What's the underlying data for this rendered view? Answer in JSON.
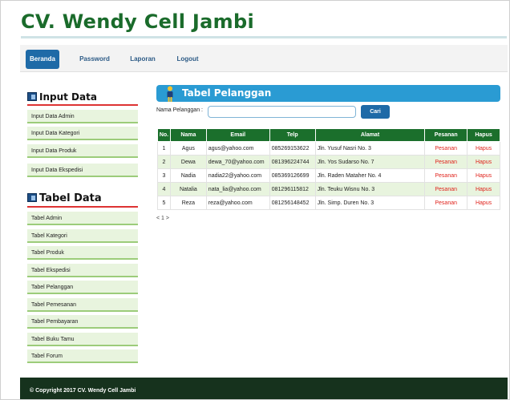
{
  "site": {
    "title": "CV. Wendy Cell Jambi"
  },
  "nav": [
    {
      "label": "Beranda",
      "active": true
    },
    {
      "label": "Password",
      "active": false
    },
    {
      "label": "Laporan",
      "active": false
    },
    {
      "label": "Logout",
      "active": false
    }
  ],
  "sidebar": {
    "input_heading": "Input Data",
    "input_items": [
      "Input Data Admin",
      "Input Data Kategori",
      "Input Data Produk",
      "Input Data Ekspedisi"
    ],
    "table_heading": "Tabel Data",
    "table_items": [
      "Tabel Admin",
      "Tabel Kategori",
      "Tabel Produk",
      "Tabel Ekspedisi",
      "Tabel Pelanggan",
      "Tabel Pemesanan",
      "Tabel Pembayaran",
      "Tabel Buku Tamu",
      "Tabel Forum"
    ]
  },
  "main": {
    "title": "Tabel Pelanggan",
    "search": {
      "label": "Nama Pelanggan :",
      "value": "",
      "placeholder": "",
      "button": "Cari"
    },
    "table": {
      "headers": [
        "No.",
        "Nama",
        "Email",
        "Telp",
        "Alamat",
        "Pesanan",
        "Hapus"
      ],
      "rows": [
        [
          "1",
          "Agus",
          "agus@yahoo.com",
          "085269153622",
          "Jln. Yusuf Nasri No. 3",
          "Pesanan",
          "Hapus"
        ],
        [
          "2",
          "Dewa",
          "dewa_70@yahoo.com",
          "081396224744",
          "Jln. Yos Sudarso No. 7",
          "Pesanan",
          "Hapus"
        ],
        [
          "3",
          "Nadia",
          "nadia22@yahoo.com",
          "085369126699",
          "Jln. Raden Mataher No. 4",
          "Pesanan",
          "Hapus"
        ],
        [
          "4",
          "Natalia",
          "nata_lia@yahoo.com",
          "081296115812",
          "Jln. Teuku Wisnu No. 3",
          "Pesanan",
          "Hapus"
        ],
        [
          "5",
          "Reza",
          "reza@yahoo.com",
          "081256148452",
          "Jln. Simp. Duren No. 3",
          "Pesanan",
          "Hapus"
        ]
      ]
    },
    "pager": "< 1 >"
  },
  "footer": {
    "text": "© Copyright 2017 CV. Wendy Cell Jambi"
  },
  "colors": {
    "brand_green": "#1a6b2b",
    "nav_active": "#1e6aa7",
    "panel_blue": "#2a9bd3",
    "link_red": "#e0241d",
    "footer_bg": "#16321d"
  }
}
